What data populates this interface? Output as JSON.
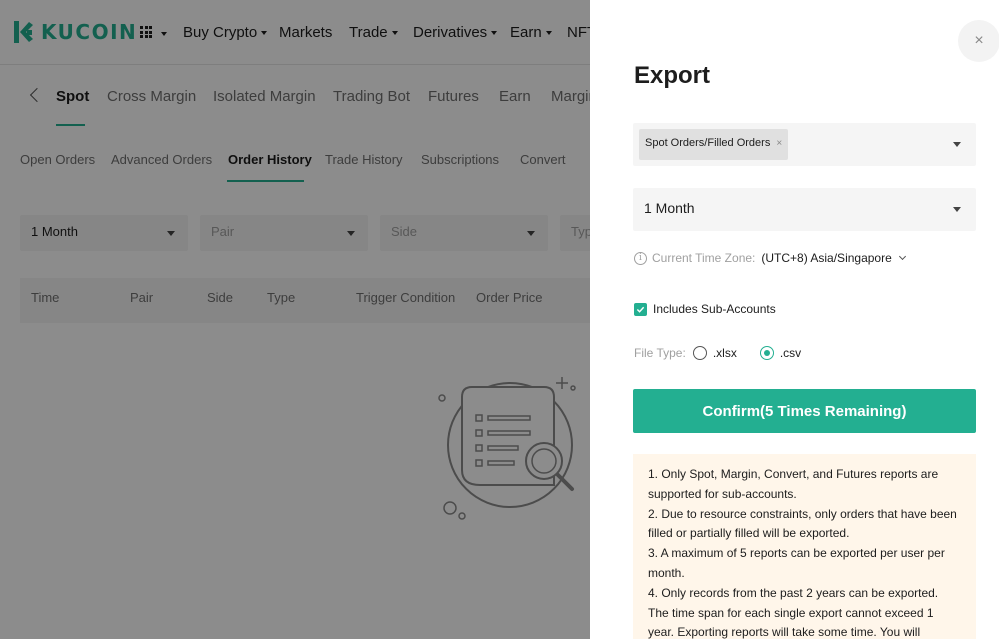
{
  "header": {
    "brand": "KUCOIN",
    "nav_items": [
      "Buy Crypto",
      "Markets",
      "Trade",
      "Derivatives",
      "Earn",
      "NFT"
    ]
  },
  "subnav": {
    "tabs": [
      "Spot",
      "Cross Margin",
      "Isolated Margin",
      "Trading Bot",
      "Futures",
      "Earn",
      "Margin"
    ]
  },
  "order_tabs": [
    "Open Orders",
    "Advanced Orders",
    "Order History",
    "Trade History",
    "Subscriptions",
    "Convert"
  ],
  "filters": {
    "period": "1 Month",
    "pair_placeholder": "Pair",
    "side_placeholder": "Side",
    "type_placeholder": "Typ"
  },
  "table": {
    "columns": [
      "Time",
      "Pair",
      "Side",
      "Type",
      "Trigger Condition",
      "Order Price"
    ]
  },
  "export_drawer": {
    "close_label": "×",
    "title": "Export",
    "report_type_tag": "Spot Orders/Filled Orders",
    "tag_remove": "×",
    "period_value": "1 Month",
    "timezone_label": "Current Time Zone:",
    "timezone_value": "(UTC+8) Asia/Singapore",
    "subaccounts_label": "Includes Sub-Accounts",
    "subaccounts_checked": true,
    "file_type_label": "File Type:",
    "file_types": [
      ".xlsx",
      ".csv"
    ],
    "file_type_selected": ".csv",
    "confirm_label": "Confirm(5 Times Remaining)",
    "notes": [
      "1. Only Spot, Margin, Convert, and Futures reports are supported for sub-accounts.",
      "2. Due to resource constraints, only orders that have been filled or partially filled will be exported.",
      "3. A maximum of 5 reports can be exported per user per month.",
      "4. Only records from the past 2 years can be exported. The time span for each single export cannot exceed 1 year. Exporting reports will take some time. You will"
    ]
  },
  "colors": {
    "accent": "#23af91",
    "notice_bg": "#fff6ea",
    "overlay": "rgba(0,0,0,0.45)"
  }
}
